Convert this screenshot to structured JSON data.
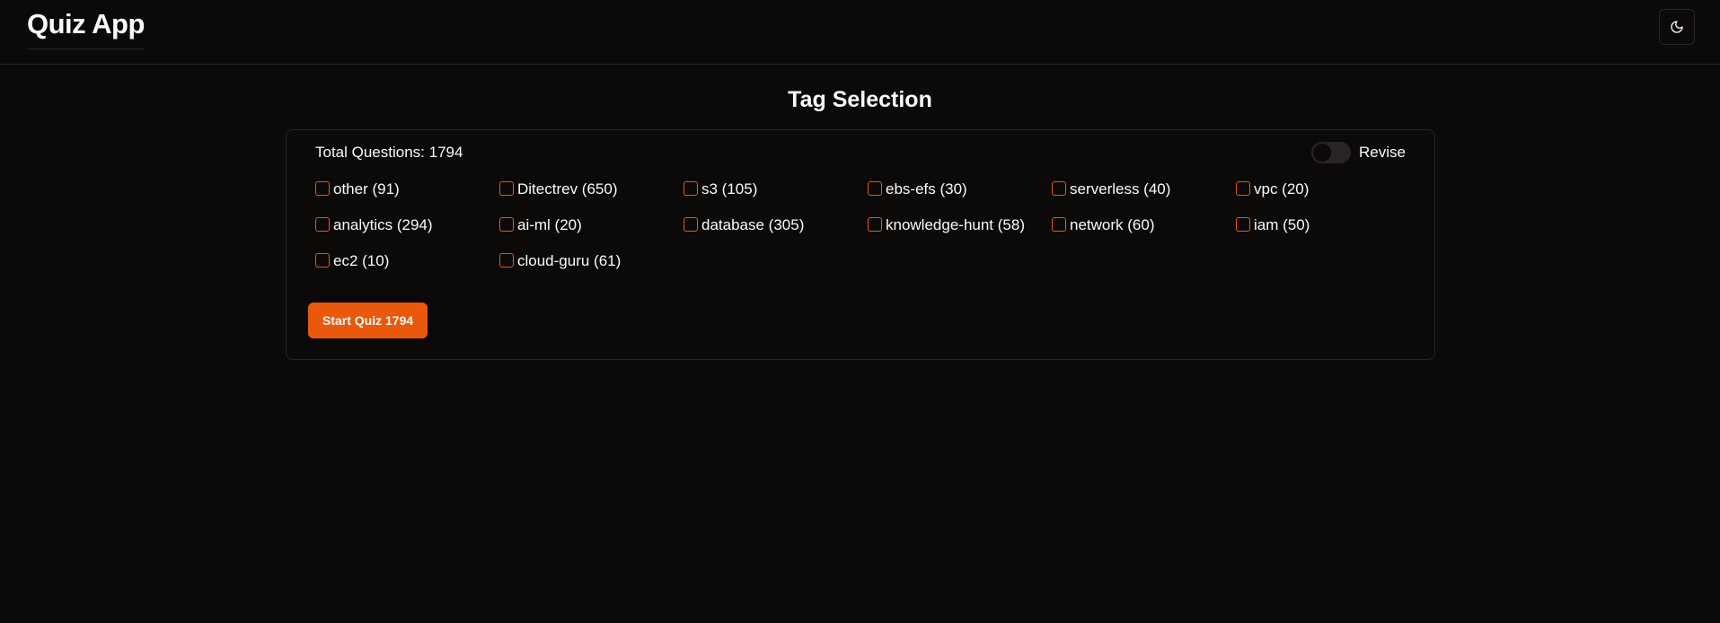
{
  "header": {
    "title": "Quiz App",
    "theme_toggle_icon": "moon-icon"
  },
  "main": {
    "heading": "Tag Selection",
    "total_questions": "Total Questions: 1794",
    "revise": {
      "label": "Revise",
      "enabled": false
    },
    "tags": [
      {
        "label": "other (91)",
        "checked": false
      },
      {
        "label": "Ditectrev (650)",
        "checked": false
      },
      {
        "label": "s3 (105)",
        "checked": false
      },
      {
        "label": "ebs-efs (30)",
        "checked": false
      },
      {
        "label": "serverless (40)",
        "checked": false
      },
      {
        "label": "vpc (20)",
        "checked": false
      },
      {
        "label": "analytics (294)",
        "checked": false
      },
      {
        "label": "ai-ml (20)",
        "checked": false
      },
      {
        "label": "database (305)",
        "checked": false
      },
      {
        "label": "knowledge-hunt (58)",
        "checked": false
      },
      {
        "label": "network (60)",
        "checked": false
      },
      {
        "label": "iam (50)",
        "checked": false
      },
      {
        "label": "ec2 (10)",
        "checked": false
      },
      {
        "label": "cloud-guru (61)",
        "checked": false
      }
    ],
    "start_button_label": "Start Quiz 1794"
  },
  "colors": {
    "background": "#0a0a09",
    "accent": "#ea580c",
    "border": "#292524",
    "text": "#fafaf9"
  }
}
